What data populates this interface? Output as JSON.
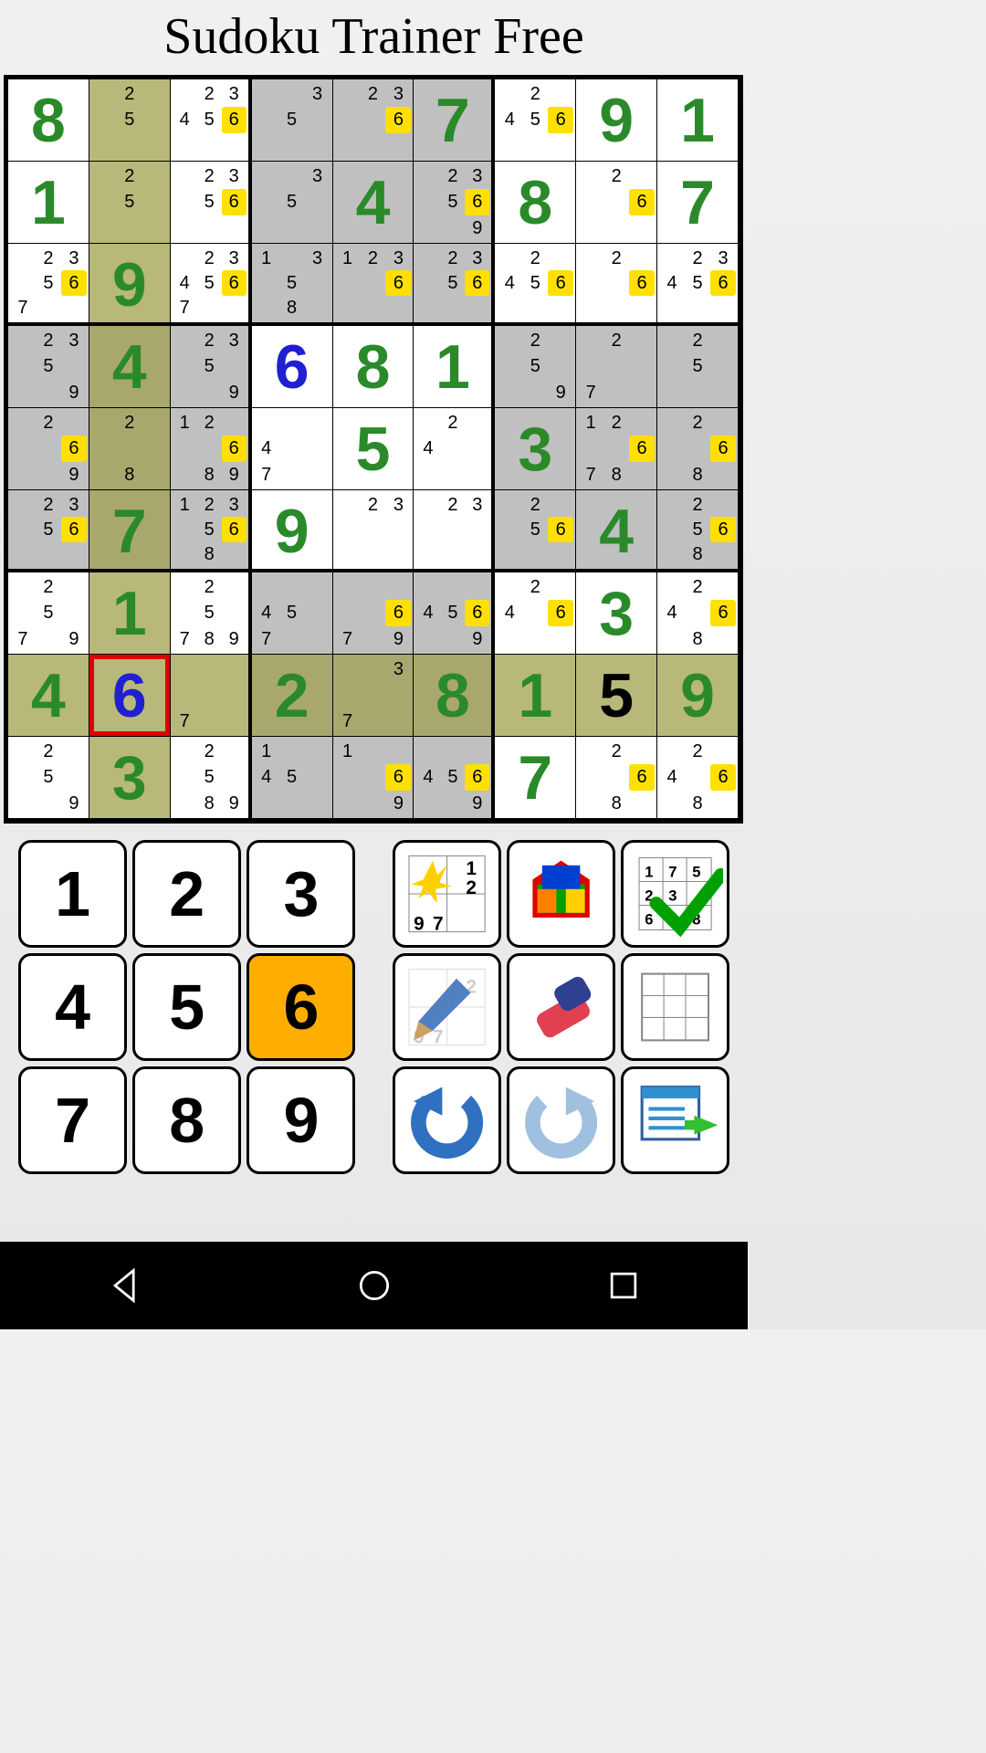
{
  "title": "Sudoku Trainer Free",
  "selected": {
    "row": 7,
    "col": 1
  },
  "highlight_col": 1,
  "numpad": [
    "1",
    "2",
    "3",
    "4",
    "5",
    "6",
    "7",
    "8",
    "9"
  ],
  "numpad_active": "6",
  "tools": [
    "hint",
    "solve",
    "check",
    "pencil",
    "erase",
    "clear",
    "undo",
    "redo",
    "menu"
  ],
  "grid": [
    [
      {
        "v": "8",
        "t": "g"
      },
      {
        "c": [
          0,
          1,
          0,
          0,
          1,
          0,
          0,
          0,
          0
        ]
      },
      {
        "c": [
          0,
          1,
          1,
          1,
          1,
          1,
          0,
          0,
          0
        ],
        "h": [
          6
        ]
      },
      {
        "c": [
          0,
          0,
          1,
          0,
          1,
          0,
          0,
          0,
          0
        ]
      },
      {
        "c": [
          0,
          1,
          1,
          0,
          0,
          1,
          0,
          0,
          0
        ],
        "h": [
          6
        ]
      },
      {
        "v": "7",
        "t": "g"
      },
      {
        "c": [
          0,
          1,
          0,
          1,
          1,
          1,
          0,
          0,
          0
        ],
        "h": [
          6
        ]
      },
      {
        "v": "9",
        "t": "g"
      },
      {
        "v": "1",
        "t": "g"
      }
    ],
    [
      {
        "v": "1",
        "t": "g"
      },
      {
        "c": [
          0,
          1,
          0,
          0,
          1,
          0,
          0,
          0,
          0
        ]
      },
      {
        "c": [
          0,
          1,
          1,
          0,
          1,
          1,
          0,
          0,
          0
        ],
        "h": [
          6
        ]
      },
      {
        "c": [
          0,
          0,
          1,
          0,
          1,
          0,
          0,
          0,
          0
        ]
      },
      {
        "v": "4",
        "t": "g"
      },
      {
        "c": [
          0,
          1,
          1,
          0,
          1,
          1,
          0,
          0,
          1
        ],
        "h": [
          6
        ]
      },
      {
        "v": "8",
        "t": "g"
      },
      {
        "c": [
          0,
          1,
          0,
          0,
          0,
          1,
          0,
          0,
          0
        ],
        "h": [
          6
        ]
      },
      {
        "v": "7",
        "t": "g"
      }
    ],
    [
      {
        "c": [
          0,
          1,
          1,
          0,
          1,
          1,
          1,
          0,
          0
        ],
        "h": [
          6
        ]
      },
      {
        "v": "9",
        "t": "g"
      },
      {
        "c": [
          0,
          1,
          1,
          1,
          1,
          1,
          1,
          0,
          0
        ],
        "h": [
          6
        ]
      },
      {
        "c": [
          1,
          0,
          1,
          0,
          1,
          0,
          0,
          1,
          0
        ]
      },
      {
        "c": [
          1,
          1,
          1,
          0,
          0,
          1,
          0,
          0,
          0
        ],
        "h": [
          6
        ]
      },
      {
        "c": [
          0,
          1,
          1,
          0,
          1,
          1,
          0,
          0,
          0
        ],
        "h": [
          6
        ]
      },
      {
        "c": [
          0,
          1,
          0,
          1,
          1,
          1,
          0,
          0,
          0
        ],
        "h": [
          6
        ]
      },
      {
        "c": [
          0,
          1,
          0,
          0,
          0,
          1,
          0,
          0,
          0
        ],
        "h": [
          6
        ]
      },
      {
        "c": [
          0,
          1,
          1,
          1,
          1,
          1,
          0,
          0,
          0
        ],
        "h": [
          6
        ]
      }
    ],
    [
      {
        "c": [
          0,
          1,
          1,
          0,
          1,
          0,
          0,
          0,
          1
        ]
      },
      {
        "v": "4",
        "t": "g"
      },
      {
        "c": [
          0,
          1,
          1,
          0,
          1,
          0,
          0,
          0,
          1
        ]
      },
      {
        "v": "6",
        "t": "u"
      },
      {
        "v": "8",
        "t": "g"
      },
      {
        "v": "1",
        "t": "g"
      },
      {
        "c": [
          0,
          1,
          0,
          0,
          1,
          0,
          0,
          0,
          1
        ]
      },
      {
        "c": [
          0,
          1,
          0,
          0,
          0,
          0,
          1,
          0,
          0
        ]
      },
      {
        "c": [
          0,
          1,
          0,
          0,
          1,
          0,
          0,
          0,
          0
        ]
      }
    ],
    [
      {
        "c": [
          0,
          1,
          0,
          0,
          0,
          1,
          0,
          0,
          1
        ],
        "h": [
          6
        ]
      },
      {
        "c": [
          0,
          1,
          0,
          0,
          0,
          0,
          0,
          1,
          0
        ]
      },
      {
        "c": [
          1,
          1,
          0,
          0,
          0,
          1,
          0,
          1,
          1
        ],
        "h": [
          6
        ]
      },
      {
        "c": [
          0,
          0,
          0,
          1,
          0,
          0,
          1,
          0,
          0
        ]
      },
      {
        "v": "5",
        "t": "g"
      },
      {
        "c": [
          0,
          1,
          0,
          1,
          0,
          0,
          0,
          0,
          0
        ]
      },
      {
        "v": "3",
        "t": "g"
      },
      {
        "c": [
          1,
          1,
          0,
          0,
          0,
          1,
          1,
          1,
          0
        ],
        "h": [
          6
        ]
      },
      {
        "c": [
          0,
          1,
          0,
          0,
          0,
          1,
          0,
          1,
          0
        ],
        "h": [
          6
        ]
      }
    ],
    [
      {
        "c": [
          0,
          1,
          1,
          0,
          1,
          1,
          0,
          0,
          0
        ],
        "h": [
          6
        ]
      },
      {
        "v": "7",
        "t": "g"
      },
      {
        "c": [
          1,
          1,
          1,
          0,
          1,
          1,
          0,
          1,
          0
        ],
        "h": [
          6
        ]
      },
      {
        "v": "9",
        "t": "g"
      },
      {
        "c": [
          0,
          1,
          1,
          0,
          0,
          0,
          0,
          0,
          0
        ]
      },
      {
        "c": [
          0,
          1,
          1,
          0,
          0,
          0,
          0,
          0,
          0
        ]
      },
      {
        "c": [
          0,
          1,
          0,
          0,
          1,
          1,
          0,
          0,
          0
        ],
        "h": [
          6
        ]
      },
      {
        "v": "4",
        "t": "g"
      },
      {
        "c": [
          0,
          1,
          0,
          0,
          1,
          1,
          0,
          1,
          0
        ],
        "h": [
          6
        ]
      }
    ],
    [
      {
        "c": [
          0,
          1,
          0,
          0,
          1,
          0,
          1,
          0,
          1
        ]
      },
      {
        "v": "1",
        "t": "g"
      },
      {
        "c": [
          0,
          1,
          0,
          0,
          1,
          0,
          1,
          1,
          1
        ]
      },
      {
        "c": [
          0,
          0,
          0,
          1,
          1,
          0,
          1,
          0,
          0
        ]
      },
      {
        "c": [
          0,
          0,
          0,
          0,
          0,
          1,
          1,
          0,
          1
        ],
        "h": [
          6
        ]
      },
      {
        "c": [
          0,
          0,
          0,
          1,
          1,
          1,
          0,
          0,
          1
        ],
        "h": [
          6
        ]
      },
      {
        "c": [
          0,
          1,
          0,
          1,
          0,
          1,
          0,
          0,
          0
        ],
        "h": [
          6
        ]
      },
      {
        "v": "3",
        "t": "g"
      },
      {
        "c": [
          0,
          1,
          0,
          1,
          0,
          1,
          0,
          1,
          0
        ],
        "h": [
          6
        ]
      }
    ],
    [
      {
        "v": "4",
        "t": "g"
      },
      {
        "v": "6",
        "t": "u"
      },
      {
        "c": [
          0,
          0,
          0,
          0,
          0,
          0,
          1,
          0,
          0
        ]
      },
      {
        "v": "2",
        "t": "g"
      },
      {
        "c": [
          0,
          0,
          1,
          0,
          0,
          0,
          1,
          0,
          0
        ]
      },
      {
        "v": "8",
        "t": "g"
      },
      {
        "v": "1",
        "t": "g"
      },
      {
        "v": "5",
        "t": "f"
      },
      {
        "v": "9",
        "t": "g"
      }
    ],
    [
      {
        "c": [
          0,
          1,
          0,
          0,
          1,
          0,
          0,
          0,
          1
        ]
      },
      {
        "v": "3",
        "t": "g"
      },
      {
        "c": [
          0,
          1,
          0,
          0,
          1,
          0,
          0,
          1,
          1
        ]
      },
      {
        "c": [
          1,
          0,
          0,
          1,
          1,
          0,
          0,
          0,
          0
        ]
      },
      {
        "c": [
          1,
          0,
          0,
          0,
          0,
          1,
          0,
          0,
          1
        ],
        "h": [
          6
        ]
      },
      {
        "c": [
          0,
          0,
          0,
          1,
          1,
          1,
          0,
          0,
          1
        ],
        "h": [
          6
        ]
      },
      {
        "v": "7",
        "t": "g"
      },
      {
        "c": [
          0,
          1,
          0,
          0,
          0,
          1,
          0,
          1,
          0
        ],
        "h": [
          6
        ]
      },
      {
        "c": [
          0,
          1,
          0,
          1,
          0,
          1,
          0,
          1,
          0
        ],
        "h": [
          6
        ]
      }
    ]
  ]
}
